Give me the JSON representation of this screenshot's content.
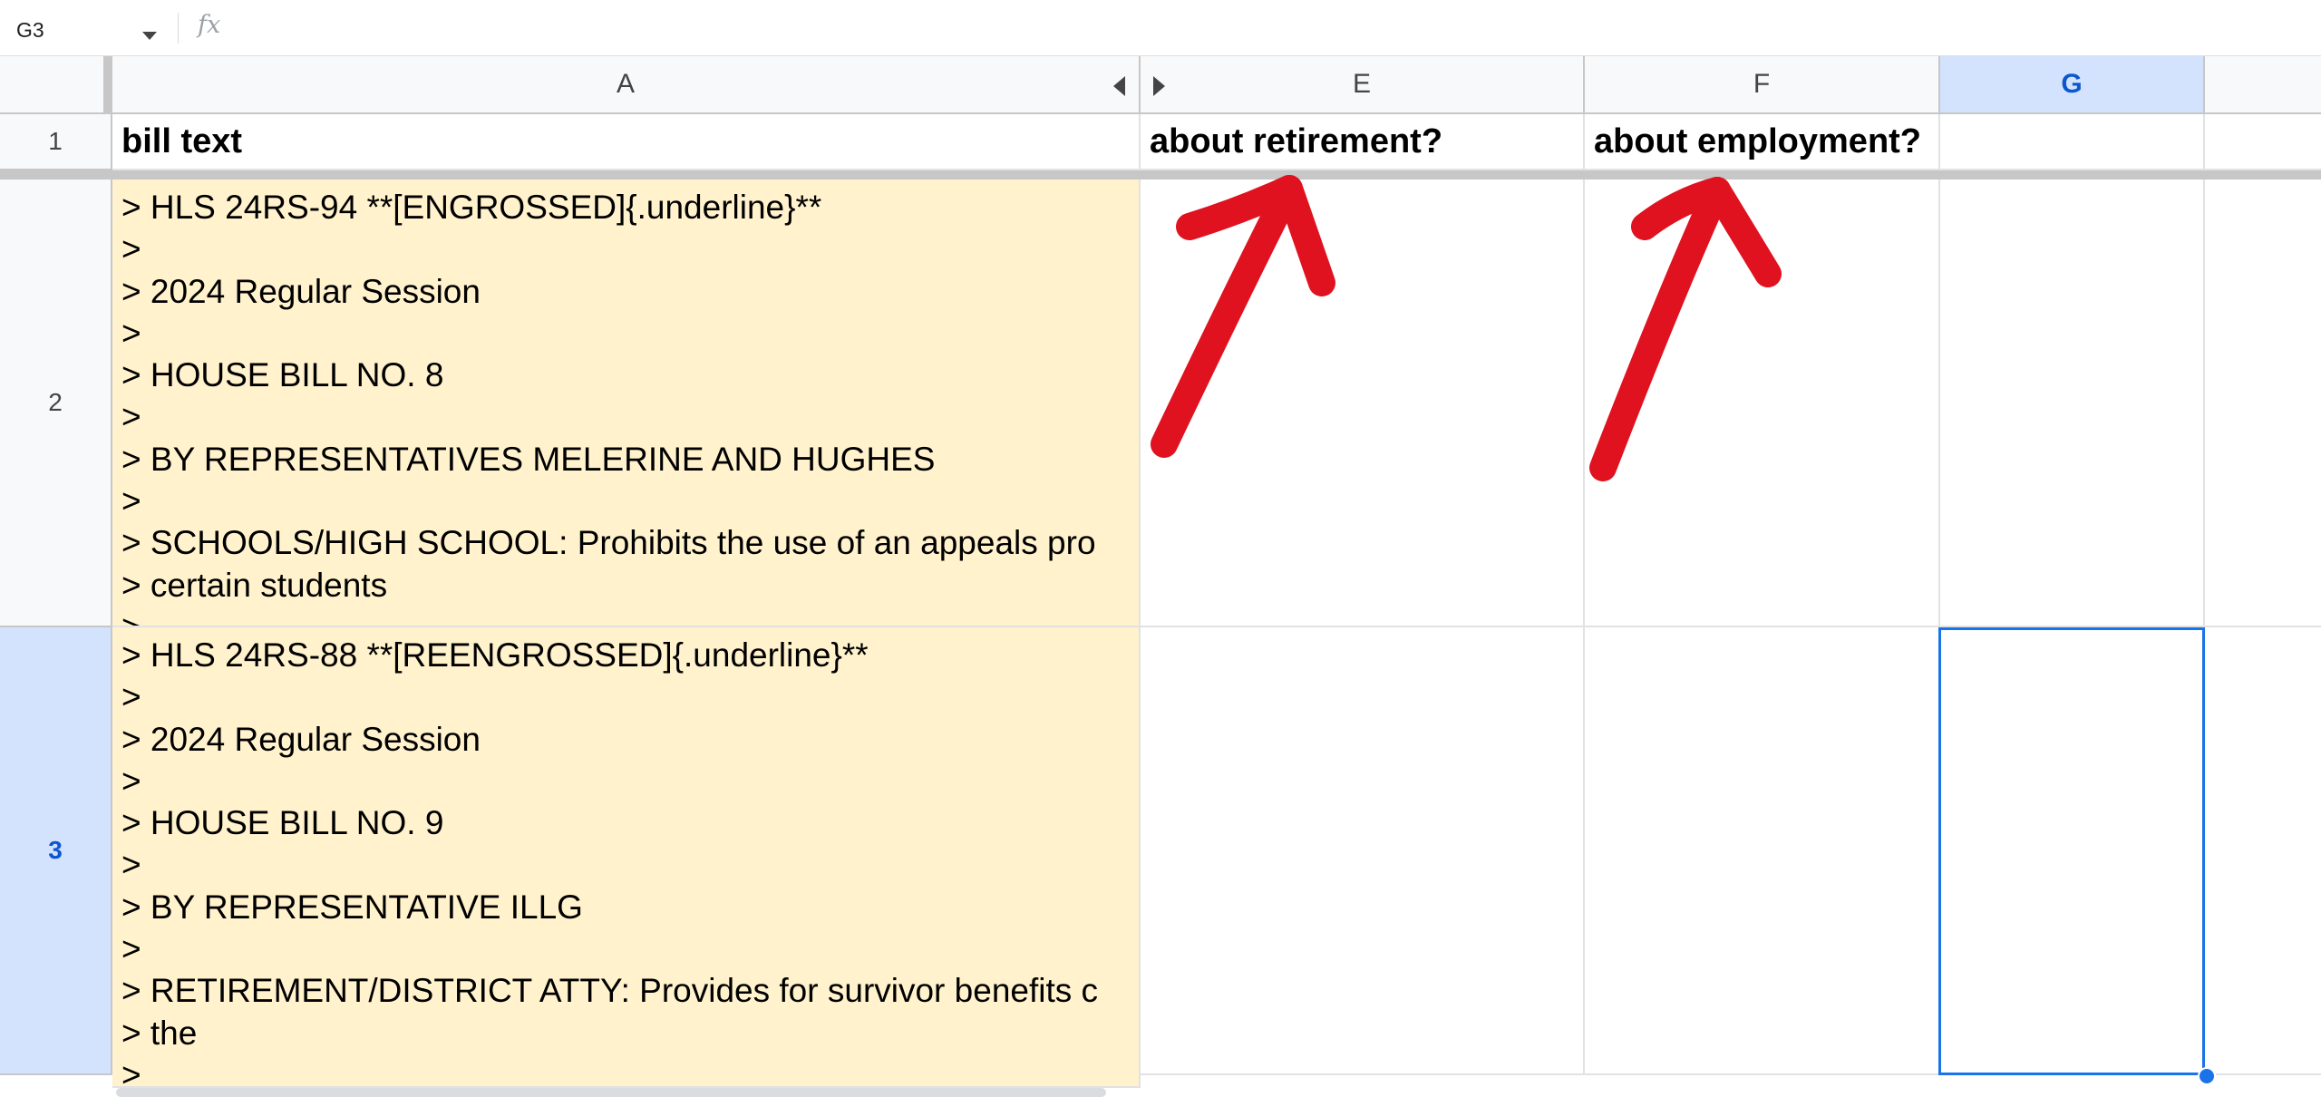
{
  "formula_bar": {
    "cell_ref": "G3",
    "fx_label": "fx",
    "formula": ""
  },
  "columns": [
    {
      "letter": "A",
      "selected": false
    },
    {
      "letter": "E",
      "selected": false
    },
    {
      "letter": "F",
      "selected": false
    },
    {
      "letter": "G",
      "selected": true
    }
  ],
  "rows": [
    {
      "number": "1",
      "selected": false
    },
    {
      "number": "2",
      "selected": false
    },
    {
      "number": "3",
      "selected": true
    }
  ],
  "header_row": {
    "bill_text": "bill text",
    "about_retirement": "about retirement?",
    "about_employment": "about employment?"
  },
  "bills": [
    {
      "text": "> HLS 24RS-94 **[ENGROSSED]{.underline}**\n>\n> 2024 Regular Session\n>\n> HOUSE BILL NO. 8\n>\n> BY REPRESENTATIVES MELERINE AND HUGHES\n>\n> SCHOOLS/HIGH SCHOOL: Prohibits the use of an appeals pro\n> certain students\n>"
    },
    {
      "text": "> HLS 24RS-88 **[REENGROSSED]{.underline}**\n>\n> 2024 Regular Session\n>\n> HOUSE BILL NO. 9\n>\n> BY REPRESENTATIVE ILLG\n>\n> RETIREMENT/DISTRICT ATTY: Provides for survivor benefits c\n> the\n>"
    }
  ],
  "colors": {
    "bill_fill": "#fff2cc",
    "selection": "#1a73e8",
    "selected_header": "#d3e3fd",
    "annotation_arrow": "#e0121f"
  },
  "annotations": {
    "arrow_icon": "red-hand-drawn-arrow",
    "count": 2
  }
}
